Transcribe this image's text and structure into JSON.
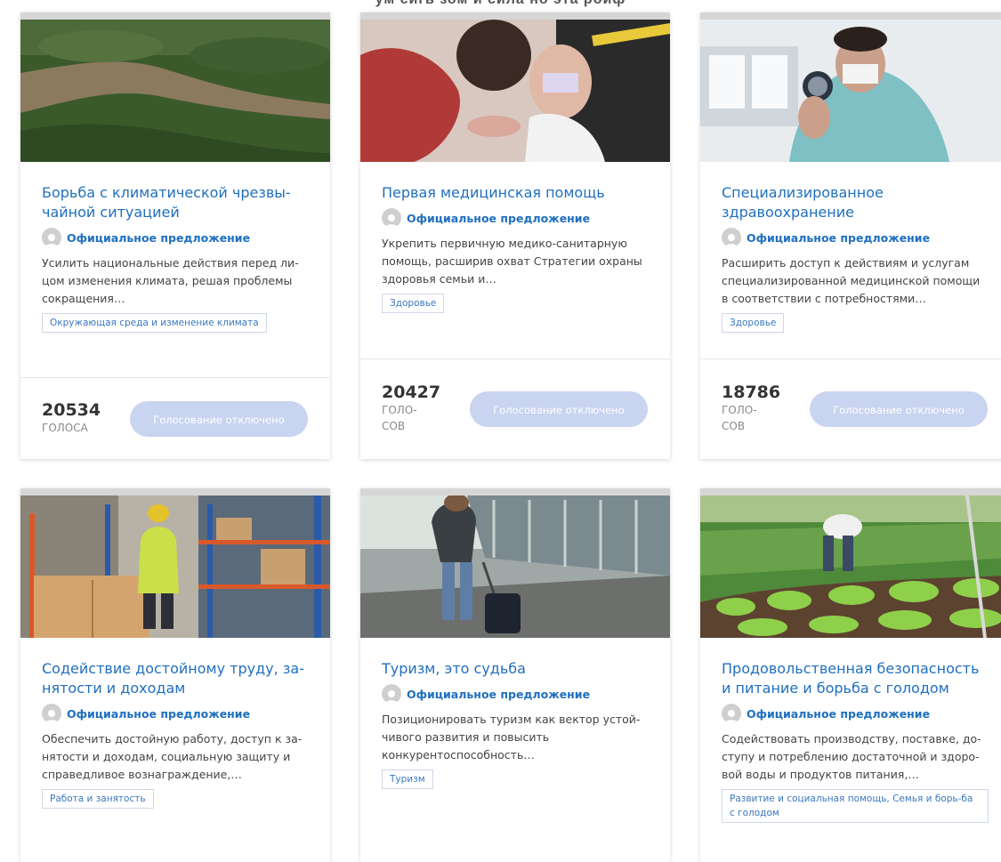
{
  "page": {
    "top_heading": "ум сигь зом и сила но эта роиф"
  },
  "cards": [
    {
      "title": "Борьба с климатической чрезвы-чайной ситуацией",
      "author": "Официальное предложение",
      "description": "Усилить национальные действия перед ли-цом изменения климата, решая проблемы сокращения…",
      "tags": [
        "Окружающая среда и изменение климата"
      ],
      "votes": "20534",
      "votes_label": "голоса",
      "button": "Голосование отключено",
      "image": "river-forest-aerial"
    },
    {
      "title": "Первая медицинская помощь",
      "author": "Официальное предложение",
      "description": "Укрепить первичную медико-санитарную помощь, расширив охват Стратегии охраны здоровья семьи и…",
      "tags": [
        "Здоровье"
      ],
      "votes": "20427",
      "votes_label": "голо-сов",
      "button": "Голосование отключено",
      "image": "child-vaccination"
    },
    {
      "title": "Специализированное здравоохранение",
      "author": "Официальное предложение",
      "description": "Расширить доступ к действиям и услугам специализированной медицинской помощи в соответствии с потребностями…",
      "tags": [
        "Здоровье"
      ],
      "votes": "18786",
      "votes_label": "голо-сов",
      "button": "Голосование отключено",
      "image": "doctor-stethoscope"
    },
    {
      "title": "Содействие достойному труду, за-нятости и доходам",
      "author": "Официальное предложение",
      "description": "Обеспечить достойную работу, доступ к за-нятости и доходам, социальную защиту и справедливое вознаграждение,…",
      "tags": [
        "Работа и занятость"
      ],
      "image": "warehouse-worker"
    },
    {
      "title": "Туризм, это судьба",
      "author": "Официальное предложение",
      "description": "Позиционировать туризм как вектор устой-чивого развития и повысить конкурентоспособность…",
      "tags": [
        "Туризм"
      ],
      "image": "traveler-suitcase"
    },
    {
      "title": "Продовольственная безопасность и питание и борьба с голодом",
      "author": "Официальное предложение",
      "description": "Содействовать производству, поставке, до-ступу и потреблению достаточной и здоро-вой воды и продуктов питания,…",
      "tags": [
        "Развитие и социальная помощь, Семья и борь-ба с голодом"
      ],
      "image": "vegetable-garden"
    }
  ],
  "colors": {
    "link": "#1f6fbf",
    "button_disabled": "#c9d4f0",
    "tag_border": "#cfd8e6"
  }
}
